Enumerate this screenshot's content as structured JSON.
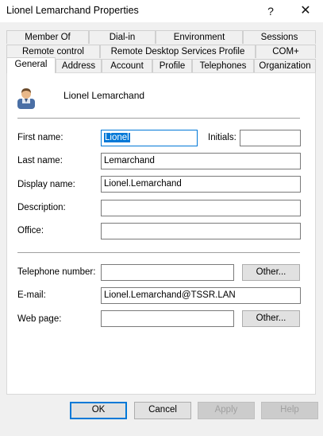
{
  "window": {
    "title": "Lionel Lemarchand Properties",
    "help_label": "?",
    "close_label": "✕"
  },
  "tabs_row1": [
    "Member Of",
    "Dial-in",
    "Environment",
    "Sessions"
  ],
  "tabs_row2": [
    "Remote control",
    "Remote Desktop Services Profile",
    "COM+"
  ],
  "tabs_row3": [
    "General",
    "Address",
    "Account",
    "Profile",
    "Telephones",
    "Organization"
  ],
  "active_tab": "General",
  "header": {
    "display": "Lionel Lemarchand",
    "icon": "user-icon"
  },
  "form": {
    "first_name_label": "First name:",
    "first_name_value": "Lionel",
    "initials_label": "Initials:",
    "initials_value": "",
    "last_name_label": "Last name:",
    "last_name_value": "Lemarchand",
    "display_name_label": "Display name:",
    "display_name_value": "Lionel.Lemarchand",
    "description_label": "Description:",
    "description_value": "",
    "office_label": "Office:",
    "office_value": "",
    "telephone_label": "Telephone number:",
    "telephone_value": "",
    "telephone_other_label": "Other...",
    "email_label": "E-mail:",
    "email_value": "Lionel.Lemarchand@TSSR.LAN",
    "webpage_label": "Web page:",
    "webpage_value": "",
    "webpage_other_label": "Other..."
  },
  "footer": {
    "ok": "OK",
    "cancel": "Cancel",
    "apply": "Apply",
    "help": "Help"
  },
  "colors": {
    "accent": "#0078d7",
    "panel": "#ffffff",
    "chrome": "#f0f0f0"
  }
}
